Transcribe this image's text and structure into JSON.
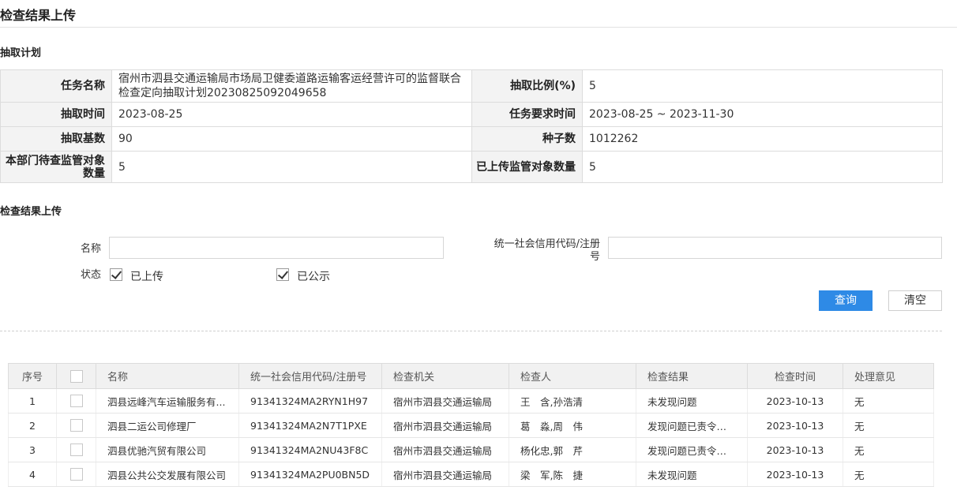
{
  "page_title": "检查结果上传",
  "plan_section_title": "抽取计划",
  "plan": {
    "task_name_label": "任务名称",
    "task_name": "宿州市泗县交通运输局市场局卫健委道路运输客运经营许可的监督联合检查定向抽取计划20230825092049658",
    "ratio_label": "抽取比例(%)",
    "ratio": "5",
    "extract_time_label": "抽取时间",
    "extract_time": "2023-08-25",
    "required_time_label": "任务要求时间",
    "required_time": "2023-08-25 ~ 2023-11-30",
    "base_label": "抽取基数",
    "base": "90",
    "seed_label": "种子数",
    "seed": "1012262",
    "pending_label": "本部门待查监管对象数量",
    "pending": "5",
    "uploaded_label": "已上传监管对象数量",
    "uploaded": "5"
  },
  "upload_section_title": "检查结果上传",
  "filter": {
    "name_label": "名称",
    "name_value": "",
    "code_label": "统一社会信用代码/注册号",
    "code_value": "",
    "status_label": "状态",
    "status_uploaded": "已上传",
    "status_uploaded_checked": true,
    "status_published": "已公示",
    "status_published_checked": true,
    "query_button": "查询",
    "clear_button": "清空"
  },
  "grid": {
    "columns": [
      "序号",
      "名称",
      "统一社会信用代码/注册号",
      "检查机关",
      "检查人",
      "检查结果",
      "检查时间",
      "处理意见"
    ],
    "rows": [
      {
        "no": "1",
        "name": "泗县远峰汽车运输服务有...",
        "code": "91341324MA2RYN1H97",
        "org": "宿州市泗县交通运输局",
        "inspector": "王　含,孙浩清",
        "result": "未发现问题",
        "time": "2023-10-13",
        "opinion": "无"
      },
      {
        "no": "2",
        "name": "泗县二运公司修理厂",
        "code": "91341324MA2N7T1PXE",
        "org": "宿州市泗县交通运输局",
        "inspector": "葛　淼,周　伟",
        "result": "发现问题已责令改正",
        "time": "2023-10-13",
        "opinion": "无"
      },
      {
        "no": "3",
        "name": "泗县优驰汽贸有限公司",
        "code": "91341324MA2NU43F8C",
        "org": "宿州市泗县交通运输局",
        "inspector": "杨化忠,郭　芹",
        "result": "发现问题已责令改正",
        "time": "2023-10-13",
        "opinion": "无"
      },
      {
        "no": "4",
        "name": "泗县公共公交发展有限公司",
        "code": "91341324MA2PU0BN5D",
        "org": "宿州市泗县交通运输局",
        "inspector": "梁　军,陈　捷",
        "result": "未发现问题",
        "time": "2023-10-13",
        "opinion": "无"
      }
    ]
  }
}
